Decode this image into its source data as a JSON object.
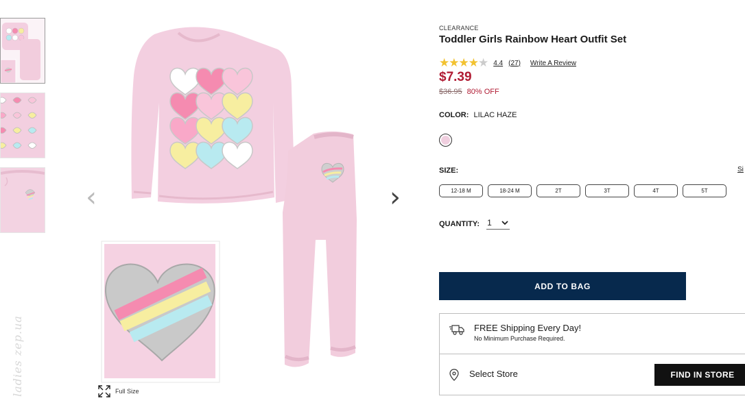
{
  "gallery": {
    "watermark": "ladies zep.ua",
    "full_size_label": "Full Size",
    "prev_icon": "chevron-left-icon",
    "next_icon": "chevron-right-icon"
  },
  "product": {
    "badge": "CLEARANCE",
    "title": "Toddler Girls Rainbow Heart Outfit Set",
    "rating": {
      "value": "4.4",
      "stars_filled": 4.4,
      "count": "(27)",
      "write_review": "Write A Review"
    },
    "price": "$7.39",
    "original_price": "$36.95",
    "discount": "80% OFF",
    "color": {
      "label": "COLOR:",
      "value": "LILAC HAZE",
      "swatch_hex": "#f0cfdf"
    },
    "size": {
      "label": "SIZE:",
      "guide": "Si",
      "options": [
        "12-18 M",
        "18-24 M",
        "2T",
        "3T",
        "4T",
        "5T"
      ]
    },
    "quantity": {
      "label": "QUANTITY:",
      "value": "1"
    },
    "add_to_bag": "ADD TO BAG",
    "shipping": {
      "title": "FREE Shipping Every Day!",
      "subtitle": "No Minimum Purchase Required."
    },
    "store": {
      "label": "Select Store",
      "find_button": "FIND IN STORE"
    }
  },
  "colors": {
    "price_red": "#b01b33",
    "navy": "#07294d",
    "star_gold": "#f2c230",
    "lilac": "#f0cfdf"
  }
}
